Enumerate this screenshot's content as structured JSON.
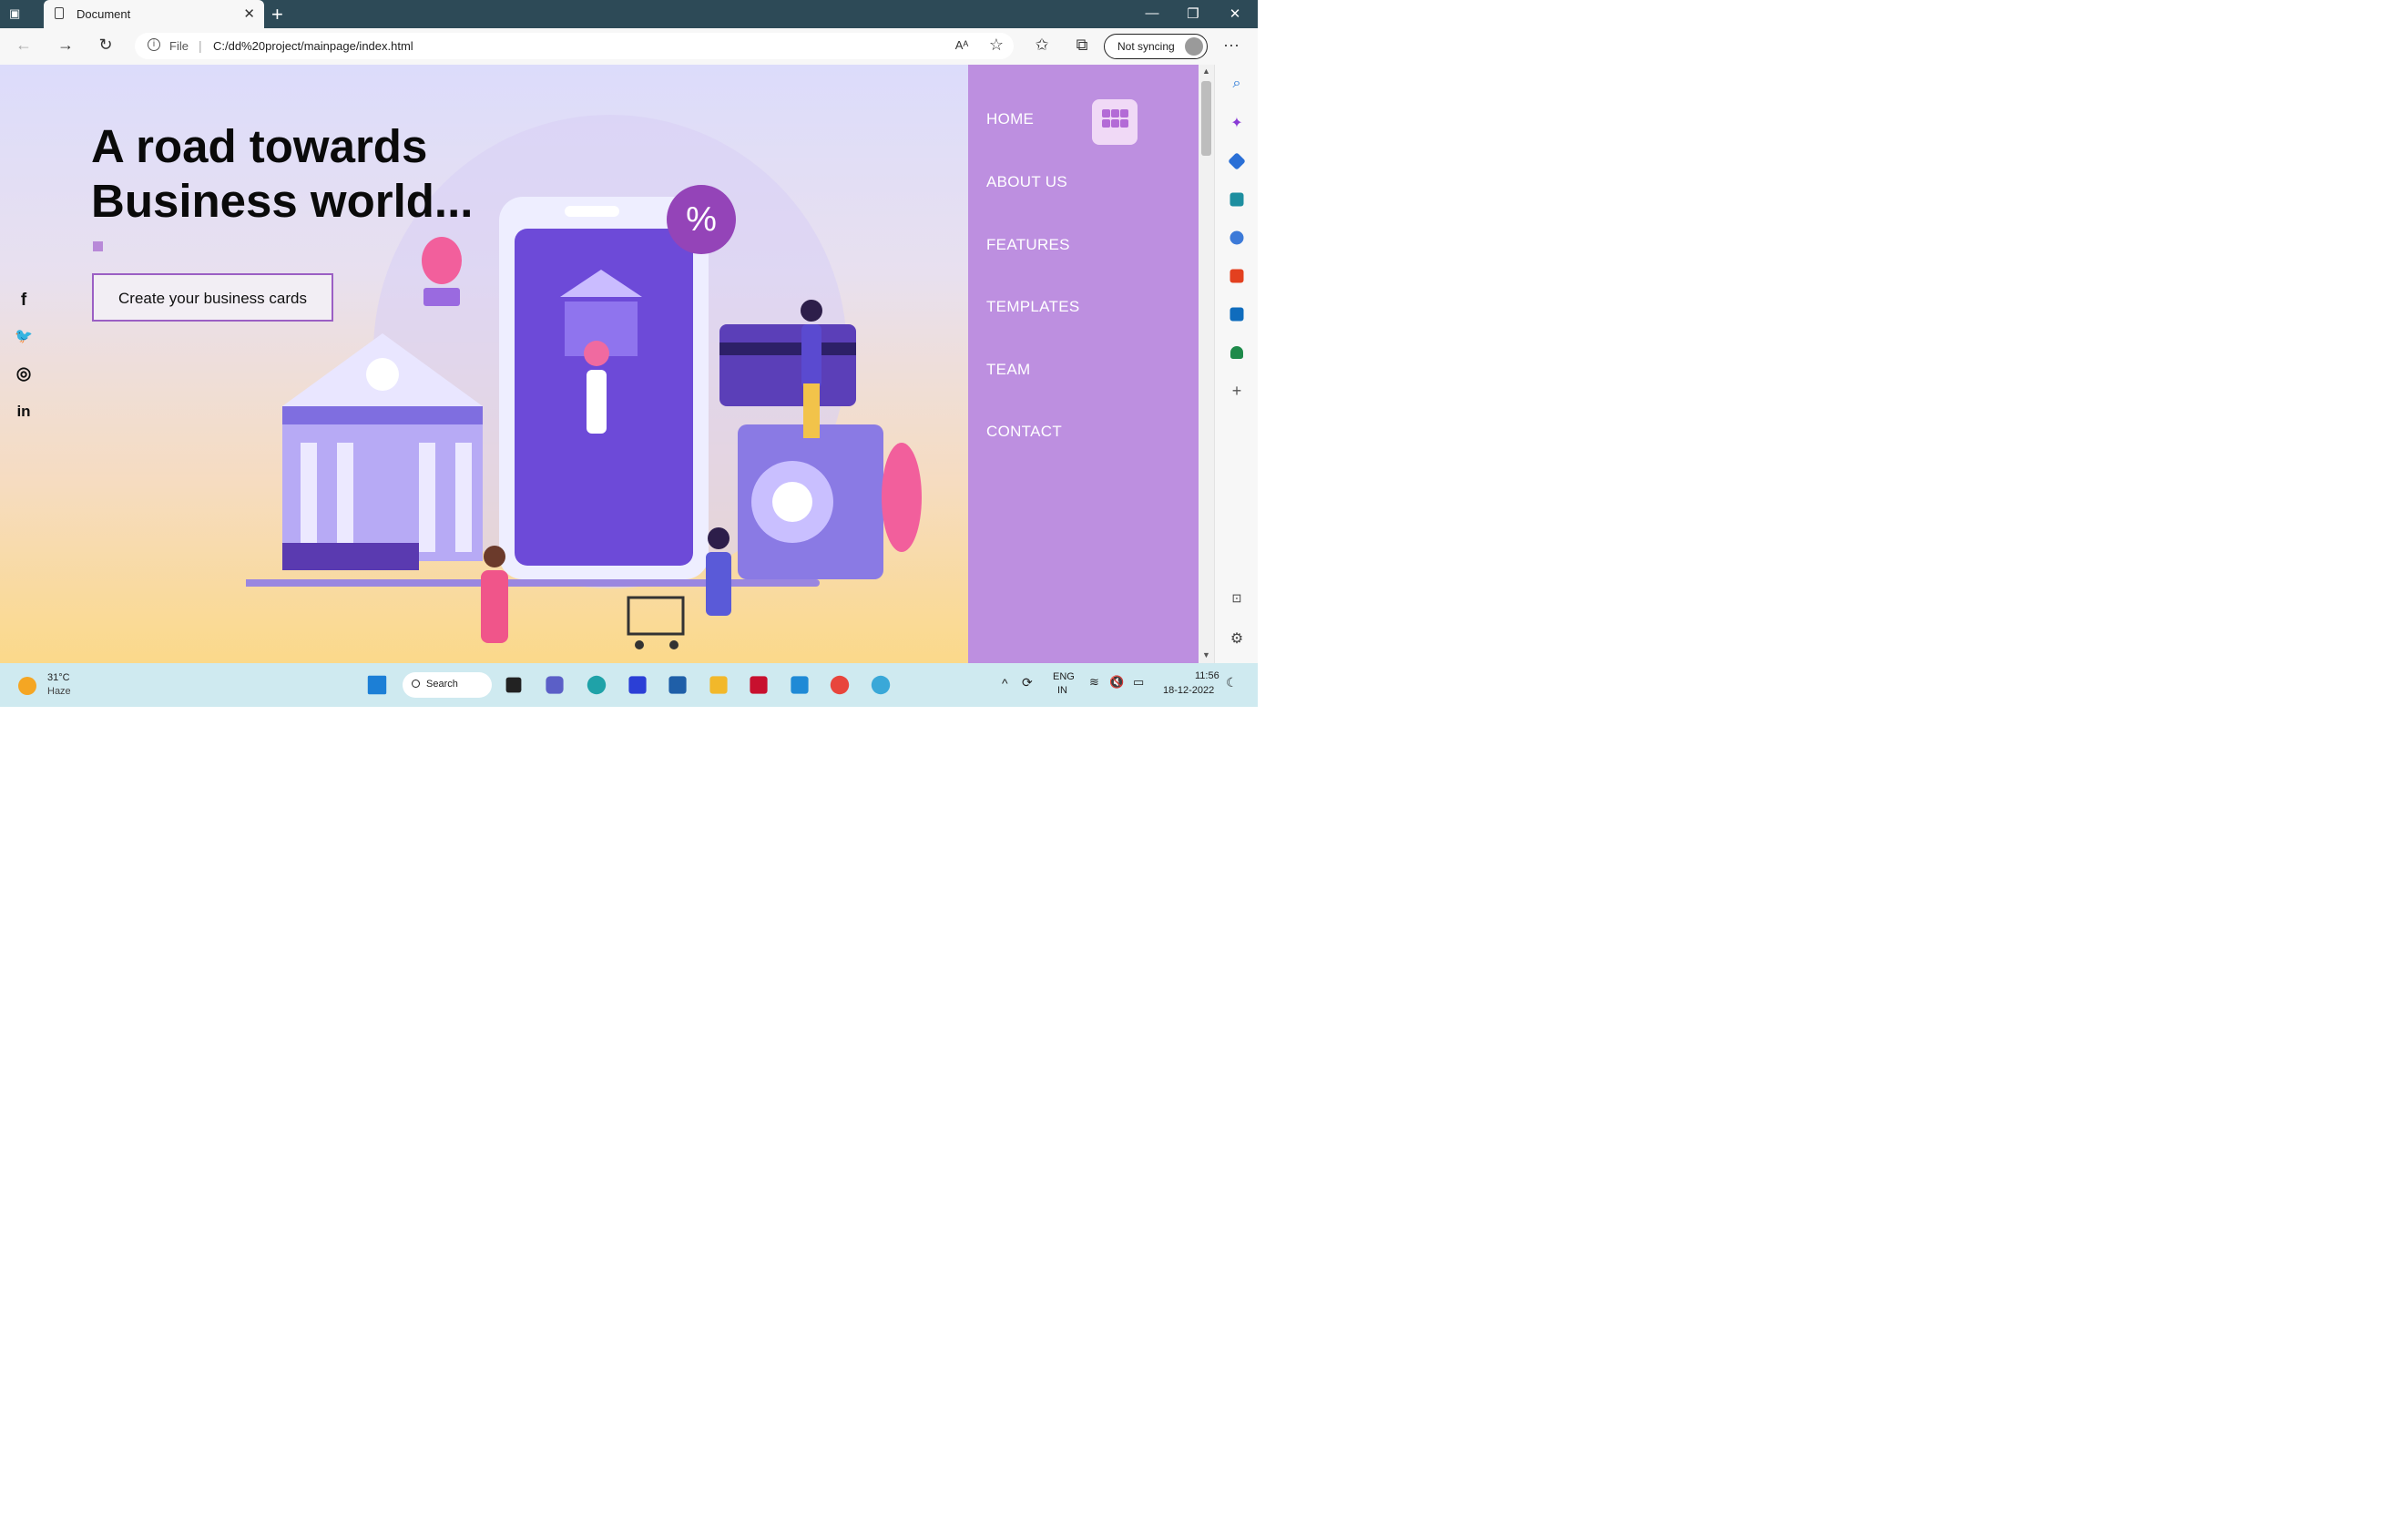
{
  "browser": {
    "tab_title": "Document",
    "new_tab": "+",
    "window_controls": {
      "minimize": "—",
      "restore": "❐",
      "close": "✕"
    },
    "address": {
      "scheme": "File",
      "url": "C:/dd%20project/mainpage/index.html"
    },
    "profile_button": "Not syncing",
    "more_icon": "···"
  },
  "page": {
    "title_lines": [
      "A road towards",
      "Business world..."
    ],
    "cta_label": "Create your business cards",
    "social": [
      "f",
      "🐦",
      "◎",
      "in"
    ],
    "nav": [
      "HOME",
      "ABOUT US",
      "FEATURES",
      "TEMPLATES",
      "TEAM",
      "CONTACT"
    ],
    "colors": {
      "sidenav": "#bd8fe0",
      "accent": "#9b5fc4",
      "menu_button": "#f0d9f6"
    }
  },
  "taskbar": {
    "weather": {
      "temp": "31°C",
      "condition": "Haze"
    },
    "search_label": "Search",
    "language": [
      "ENG",
      "IN"
    ],
    "time": "11:56",
    "date": "18-12-2022"
  }
}
